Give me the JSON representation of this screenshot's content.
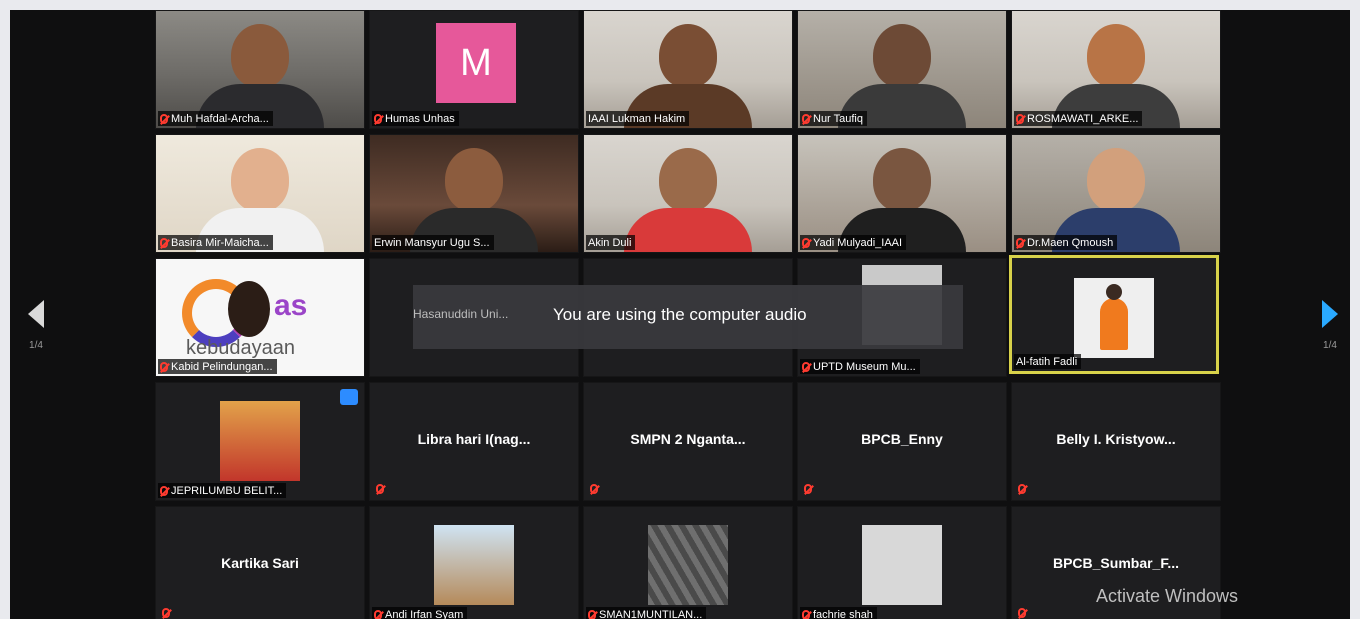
{
  "pagination": {
    "left": "1/4",
    "right": "1/4"
  },
  "toast": {
    "overlay_name": "Hasanuddin Uni...",
    "message": "You are using the computer audio"
  },
  "watermark": "Activate Windows",
  "logo": {
    "brand": "as",
    "sub": "kebudayaan"
  },
  "avatar_letter": "M",
  "participants": [
    "Muh Hafdal-Archa...",
    "Humas Unhas",
    "IAAI Lukman Hakim",
    "Nur Taufiq",
    "ROSMAWATI_ARKE...",
    "Basira Mir-Maicha...",
    "Erwin Mansyur Ugu S...",
    "Akin Duli",
    "Yadi Mulyadi_IAAI",
    "Dr.Maen Qmoush",
    "Kabid Pelindungan...",
    "UPTD Museum Mu...",
    "Al-fatih Fadli",
    "JEPRILUMBU BELIT...",
    "Libra hari I(nag...",
    "SMPN 2 Nganta...",
    "BPCB_Enny",
    "Belly I. Kristyow...",
    "Kartika Sari",
    "Andi Irfan Syam",
    "SMAN1MUNTILAN...",
    "fachrie shah",
    "BPCB_Sumbar_F..."
  ]
}
